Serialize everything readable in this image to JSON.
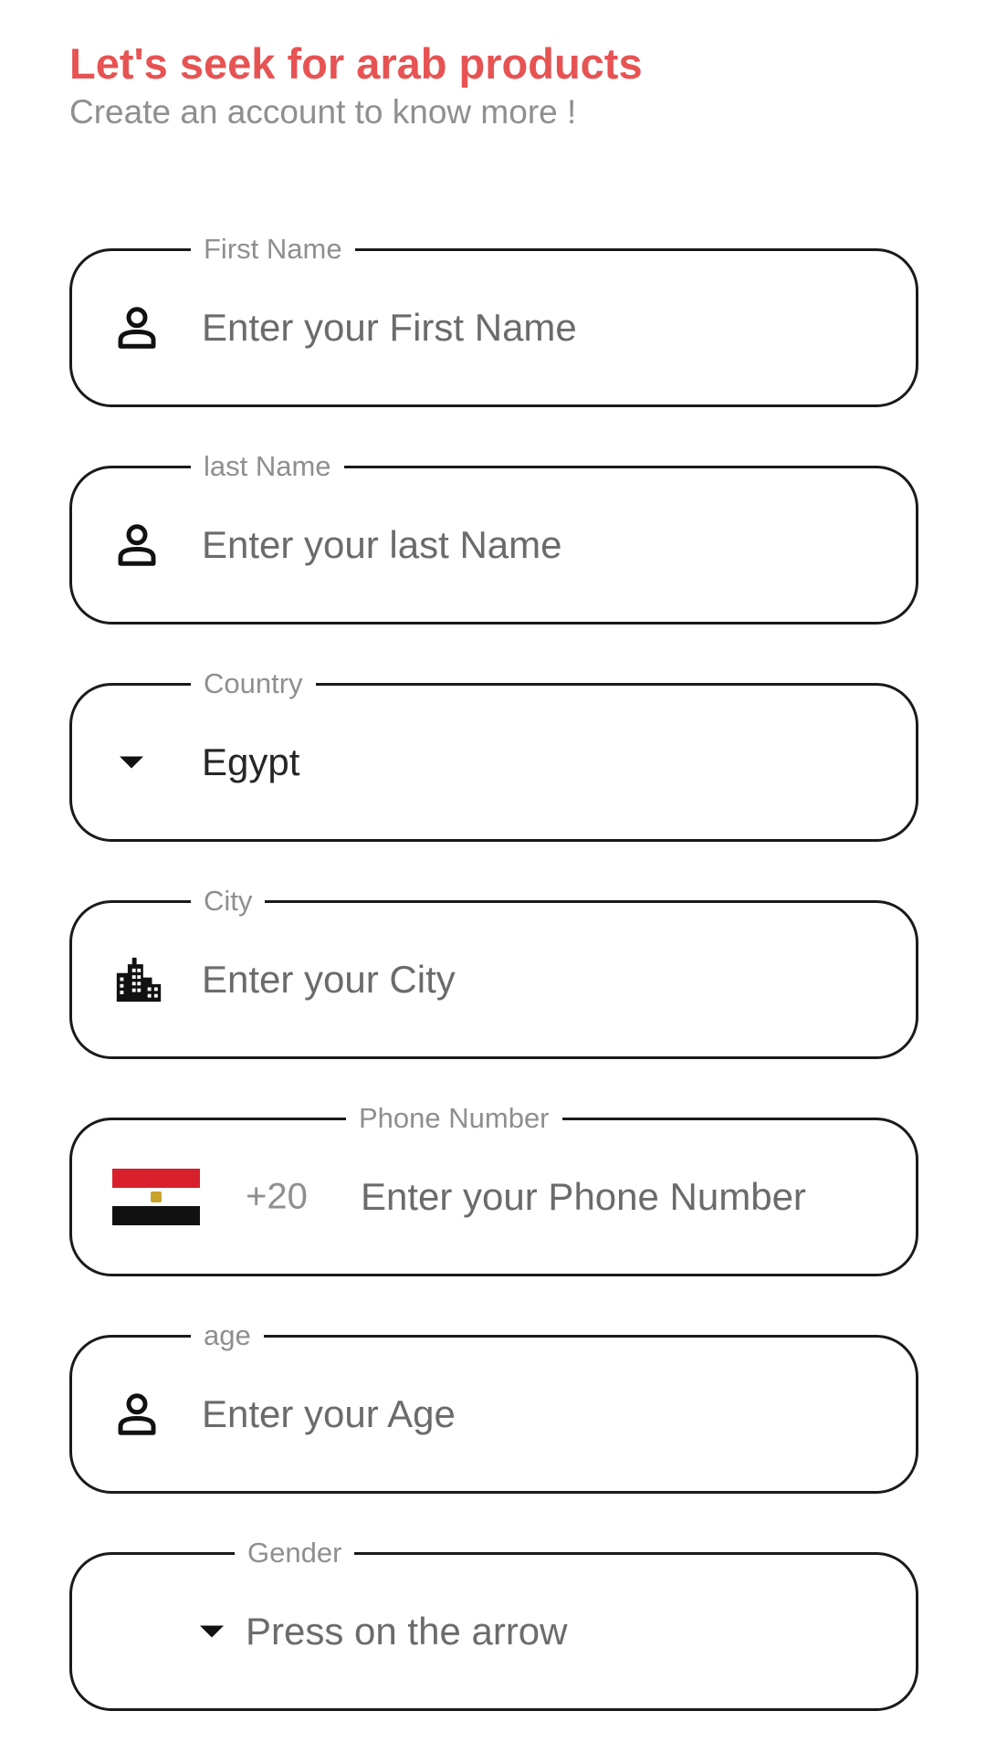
{
  "header": {
    "title": "Let's seek for arab products",
    "subtitle": "Create an account to know more !"
  },
  "colors": {
    "accent": "#E75353",
    "border": "#1a1a1a",
    "label": "#8f8f8f",
    "placeholder": "#6b6b6b"
  },
  "form": {
    "first_name": {
      "label": "First Name",
      "placeholder": "Enter your First Name",
      "icon": "person-icon"
    },
    "last_name": {
      "label": "last Name",
      "placeholder": "Enter your last Name",
      "icon": "person-icon"
    },
    "country": {
      "label": "Country",
      "value": "Egypt",
      "icon": "dropdown-arrow-icon"
    },
    "city": {
      "label": "City",
      "placeholder": "Enter your City",
      "icon": "city-icon"
    },
    "phone": {
      "label": "Phone Number",
      "dial_code": "+20",
      "placeholder": "Enter your Phone Number",
      "icon": "egypt-flag-icon"
    },
    "age": {
      "label": "age",
      "placeholder": "Enter your Age",
      "icon": "person-icon"
    },
    "gender": {
      "label": "Gender",
      "placeholder": "Press on the arrow",
      "icon": "dropdown-arrow-icon"
    }
  }
}
